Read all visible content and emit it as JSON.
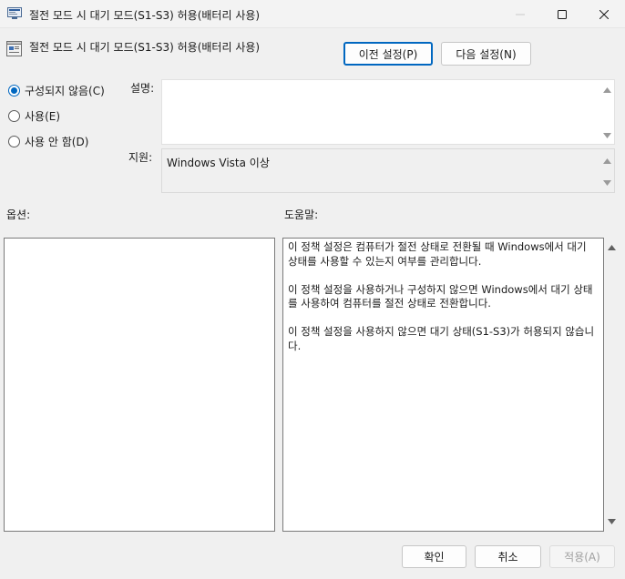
{
  "window": {
    "title": "절전 모드 시 대기 모드(S1-S3) 허용(배터리 사용)"
  },
  "policy": {
    "title": "절전 모드 시 대기 모드(S1-S3) 허용(배터리 사용)"
  },
  "nav": {
    "prev_label": "이전 설정(P)",
    "next_label": "다음 설정(N)"
  },
  "state_options": [
    {
      "label": "구성되지 않음(C)",
      "selected": true
    },
    {
      "label": "사용(E)",
      "selected": false
    },
    {
      "label": "사용 안 함(D)",
      "selected": false
    }
  ],
  "labels": {
    "description": "설명:",
    "supported_on": "지원:",
    "options": "옵션:",
    "help": "도움말:"
  },
  "supported_on_value": "Windows Vista 이상",
  "help_text": [
    "이 정책 설정은 컴퓨터가 절전 상태로 전환될 때 Windows에서 대기 상태를 사용할 수 있는지 여부를 관리합니다.",
    "이 정책 설정을 사용하거나 구성하지 않으면 Windows에서 대기 상태를 사용하여 컴퓨터를 절전 상태로 전환합니다.",
    "이 정책 설정을 사용하지 않으면 대기 상태(S1-S3)가 허용되지 않습니다."
  ],
  "footer": {
    "ok_label": "확인",
    "cancel_label": "취소",
    "apply_label": "적용(A)"
  },
  "colors": {
    "accent": "#0067c0",
    "disabled_text": "#a0a0a0"
  },
  "icons": {
    "app": "policy-editor-icon",
    "setting": "policy-setting-icon",
    "minimize": "minimize-icon",
    "maximize": "maximize-icon",
    "close": "close-icon"
  }
}
